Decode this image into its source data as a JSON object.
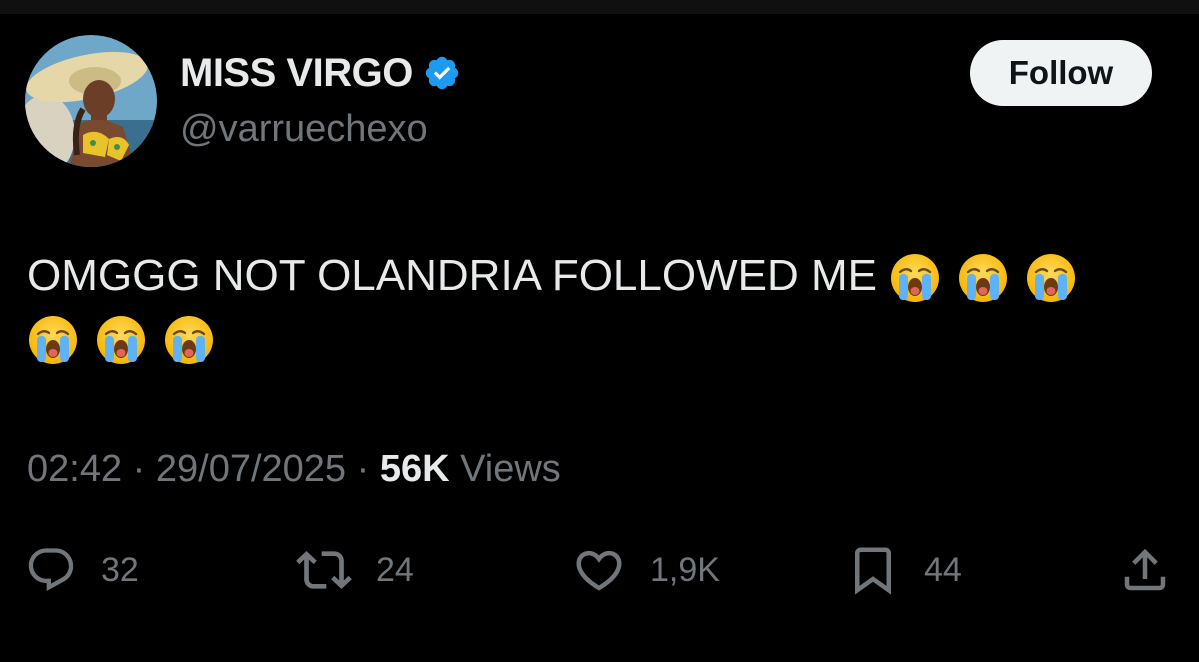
{
  "tweet": {
    "author": {
      "display_name": "MISS VIRGO",
      "handle": "@varruechexo",
      "verified": true,
      "avatar_icon": "avatar-photo"
    },
    "follow_label": "Follow",
    "text": "OMGGG NOT OLANDRIA FOLLOWED ME",
    "emojis": [
      "loudly-crying-face",
      "loudly-crying-face",
      "loudly-crying-face",
      "loudly-crying-face",
      "loudly-crying-face",
      "loudly-crying-face"
    ],
    "time": "02:42",
    "date": "29/07/2025",
    "separator": "·",
    "views_count": "56K",
    "views_label": "Views",
    "actions": {
      "replies": "32",
      "reposts": "24",
      "likes": "1,9K",
      "bookmarks": "44"
    }
  },
  "colors": {
    "background": "#000000",
    "primary_text": "#e7e9ea",
    "secondary_text": "#71767b",
    "verified_blue": "#1d9bf0",
    "follow_button_bg": "#eff3f4",
    "follow_button_text": "#0f1419"
  }
}
